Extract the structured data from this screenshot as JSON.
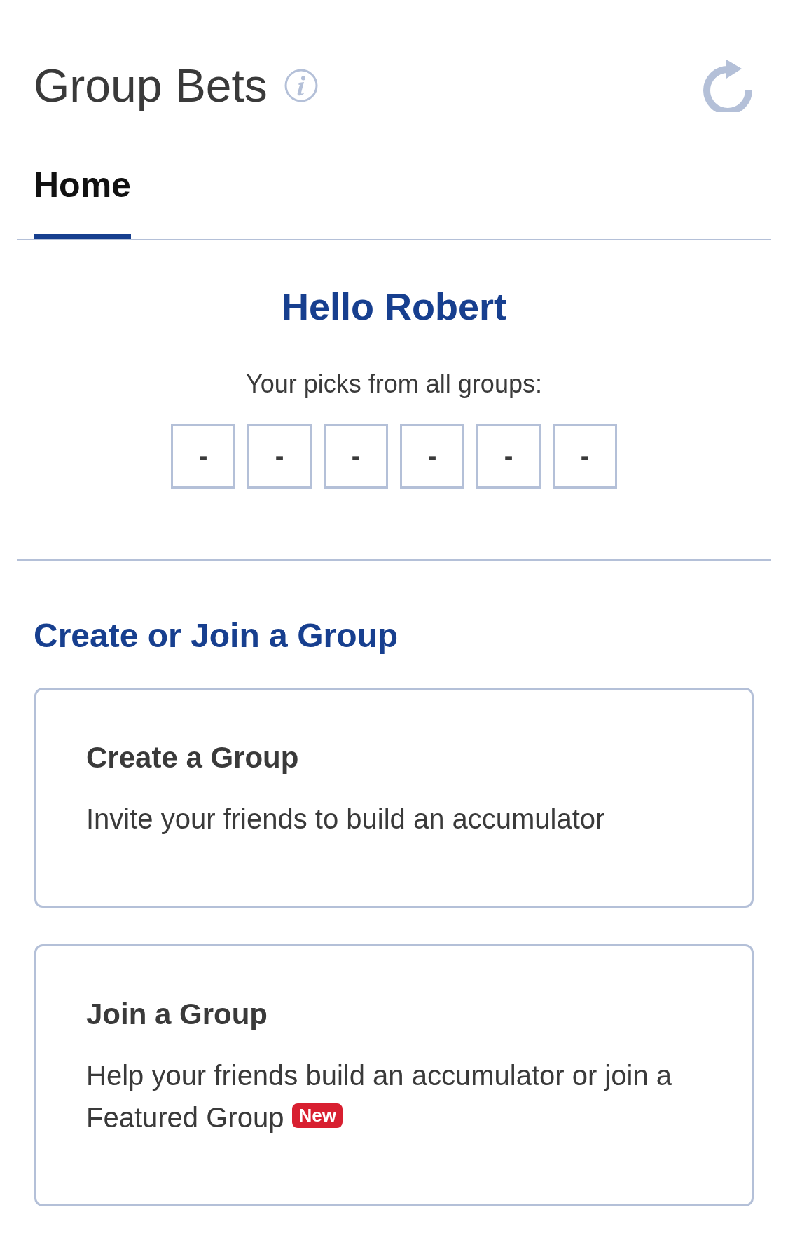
{
  "header": {
    "title": "Group Bets"
  },
  "tabs": [
    {
      "label": "Home",
      "selected": true
    }
  ],
  "greeting": "Hello Robert",
  "picks": {
    "label": "Your picks from all groups:",
    "slots": [
      "-",
      "-",
      "-",
      "-",
      "-",
      "-"
    ]
  },
  "section": {
    "title": "Create or Join a Group",
    "cards": [
      {
        "title": "Create a Group",
        "description": "Invite your friends to build an accumulator"
      },
      {
        "title": "Join a Group",
        "description": "Help your friends build an accumulator or join a Featured Group",
        "badge": "New"
      }
    ]
  }
}
